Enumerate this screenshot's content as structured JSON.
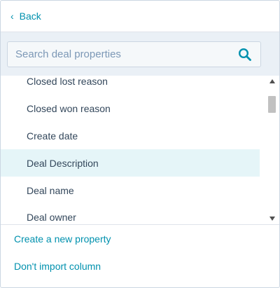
{
  "back": {
    "chevron": "‹",
    "label": "Back"
  },
  "search": {
    "placeholder": "Search deal properties",
    "value": "",
    "icon": "search-icon"
  },
  "properties": {
    "items": [
      {
        "label": "Closed lost reason"
      },
      {
        "label": "Closed won reason"
      },
      {
        "label": "Create date"
      },
      {
        "label": "Deal Description",
        "highlighted": true
      },
      {
        "label": "Deal name"
      },
      {
        "label": "Deal owner"
      }
    ]
  },
  "footer": {
    "create_label": "Create a new property",
    "dont_import_label": "Don't import column"
  },
  "colors": {
    "accent": "#0091ae",
    "text": "#33475b",
    "search_band": "#eaf0f6",
    "highlight": "#e5f5f8",
    "border": "#cbd6e2"
  }
}
